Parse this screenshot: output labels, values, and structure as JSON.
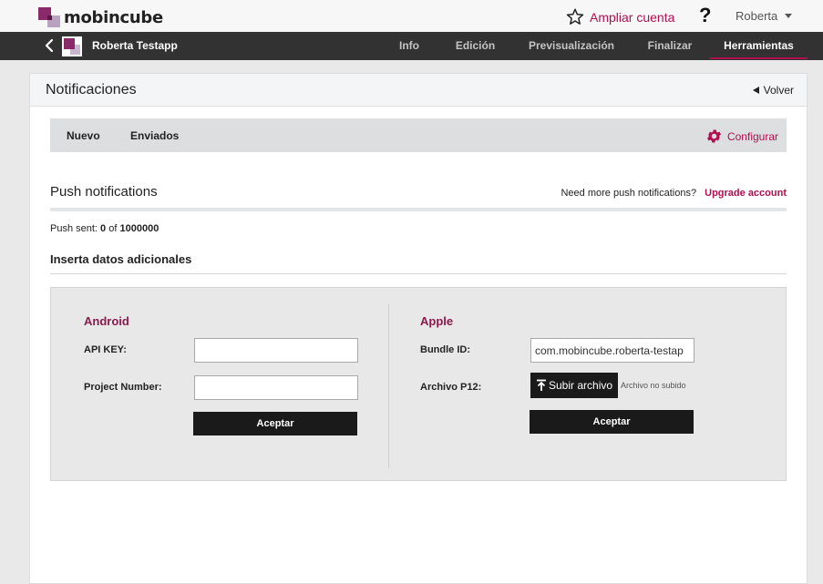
{
  "header": {
    "brand": "mobincube",
    "upgrade_label": "Ampliar cuenta",
    "help_label": "?",
    "user_name": "Roberta"
  },
  "nav": {
    "app_name": "Roberta Testapp",
    "tabs": [
      {
        "label": "Info",
        "active": false
      },
      {
        "label": "Edición",
        "active": false
      },
      {
        "label": "Previsualización",
        "active": false
      },
      {
        "label": "Finalizar",
        "active": false
      },
      {
        "label": "Herramientas",
        "active": true
      }
    ]
  },
  "panel": {
    "title": "Notificaciones",
    "back_label": "Volver",
    "subtabs": [
      "Nuevo",
      "Enviados"
    ],
    "config_label": "Configurar",
    "push_title": "Push notifications",
    "need_more_text": "Need more push notifications?",
    "upgrade_link": "Upgrade account",
    "push_sent_label": "Push sent:",
    "push_sent_count": "0",
    "push_sent_of": "of",
    "push_sent_limit": "1000000",
    "extra_title": "Inserta datos adicionales"
  },
  "android": {
    "title": "Android",
    "api_key_label": "API KEY:",
    "api_key_value": "",
    "project_number_label": "Project Number:",
    "project_number_value": "",
    "submit_label": "Aceptar"
  },
  "apple": {
    "title": "Apple",
    "bundle_label": "Bundle ID:",
    "bundle_value": "com.mobincube.roberta-testap",
    "p12_label": "Archivo P12:",
    "upload_label": "Subir archivo",
    "upload_status": "Archivo no subido",
    "submit_label": "Aceptar"
  },
  "colors": {
    "accent": "#b0104f",
    "section_title": "#8a1b4c",
    "nav_bg": "#323232"
  }
}
